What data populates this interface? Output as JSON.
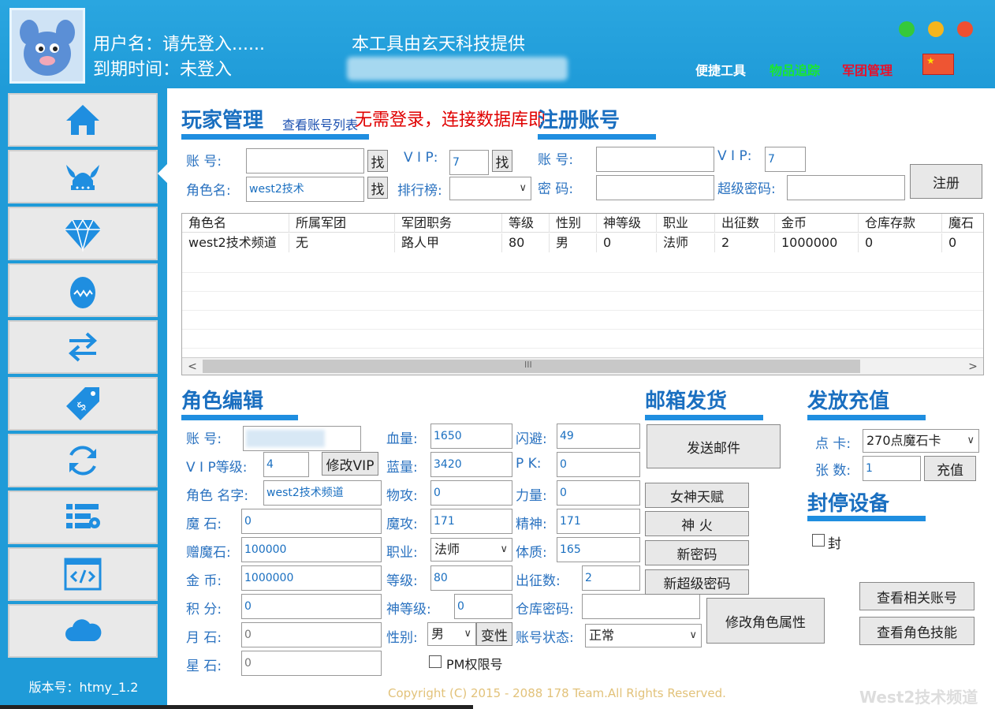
{
  "header": {
    "username_line": "用户名：请先登入......",
    "expire_line": "到期时间：未登入",
    "provider": "本工具由玄天科技提供",
    "links": [
      {
        "label": "便捷工具",
        "color": "#ffffff"
      },
      {
        "label": "物品追踪",
        "color": "#19e633"
      },
      {
        "label": "军团管理",
        "color": "#e8102a"
      }
    ],
    "flag_glyph": "★",
    "window_dots": [
      "#35c93a",
      "#f6b51c",
      "#ef4f30"
    ]
  },
  "sidebar": {
    "items": [
      "home-icon",
      "viking-helmet-icon",
      "diamond-icon",
      "egg-icon",
      "swap-arrows-icon",
      "price-tag-icon",
      "refresh-icon",
      "list-settings-icon",
      "code-window-icon",
      "cloud-icon"
    ],
    "version": "版本号：htmy_1.2"
  },
  "player": {
    "title": "玩家管理",
    "view_list_link": "查看账号列表",
    "notice": "无需登录，连接数据库即",
    "account_label": "账  号:",
    "role_label": "角色名:",
    "role_value": "west2技术",
    "vip_label": "V I P:",
    "vip_value": "7",
    "rank_label": "排行榜:",
    "find_label": "找"
  },
  "register": {
    "title": "注册账号",
    "account_label": "账  号:",
    "password_label": "密  码:",
    "vip_label": "V I P:",
    "vip_value": "7",
    "super_pw_label": "超级密码:",
    "register_button": "注册"
  },
  "table": {
    "columns": [
      "角色名",
      "所属军团",
      "军团职务",
      "等级",
      "性别",
      "神等级",
      "职业",
      "出征数",
      "金币",
      "仓库存款",
      "魔石"
    ],
    "rows": [
      [
        "west2技术频道",
        "无",
        "路人甲",
        "80",
        "男",
        "0",
        "法师",
        "2",
        "1000000",
        "0",
        "0"
      ]
    ],
    "scroll_thumb": "III"
  },
  "role_edit": {
    "title": "角色编辑",
    "account_label": "账  号:",
    "vip_level_label": "V I P等级:",
    "vip_level_value": "4",
    "modify_vip": "修改VIP",
    "role_name_label": "角色 名字:",
    "role_name_value": "west2技术频道",
    "magic_stone_label": "魔  石:",
    "magic_stone_value": "0",
    "gift_stone_label": "赠魔石:",
    "gift_stone_value": "100000",
    "gold_label": "金  币:",
    "gold_value": "1000000",
    "points_label": "积  分:",
    "points_value": "0",
    "moon_stone_label": "月  石:",
    "moon_stone_value": "0",
    "star_stone_label": "星  石:",
    "star_stone_value": "0",
    "hp_label": "血量:",
    "hp_value": "1650",
    "mp_label": "蓝量:",
    "mp_value": "3420",
    "phy_atk_label": "物攻:",
    "phy_atk_value": "0",
    "mag_atk_label": "魔攻:",
    "mag_atk_value": "171",
    "job_label": "职业:",
    "job_value": "法师",
    "level_label": "等级:",
    "level_value": "80",
    "god_level_label": "神等级:",
    "god_level_value": "0",
    "gender_label": "性别:",
    "gender_value": "男",
    "change_gender": "变性",
    "pm_label": "PM权限号",
    "dodge_label": "闪避:",
    "dodge_value": "49",
    "pk_label": "P  K:",
    "pk_value": "0",
    "str_label": "力量:",
    "str_value": "0",
    "spirit_label": "精神:",
    "spirit_value": "171",
    "con_label": "体质:",
    "con_value": "165",
    "expedition_label": "出征数:",
    "expedition_value": "2",
    "warehouse_pw_label": "仓库密码:",
    "account_status_label": "账号状态:",
    "account_status_value": "正常",
    "modify_attr": "修改角色属性"
  },
  "mail": {
    "title": "邮箱发货",
    "send_mail": "发送邮件",
    "goddess_talent": "女神天赋",
    "divine_fire": "神  火",
    "new_password": "新密码",
    "new_super_password": "新超级密码"
  },
  "recharge": {
    "title": "发放充值",
    "card_label": "点 卡:",
    "card_value": "270点魔石卡",
    "count_label": "张 数:",
    "count_value": "1",
    "recharge_button": "充值"
  },
  "ban": {
    "title": "封停设备",
    "ban_label": "封"
  },
  "actions": {
    "view_related": "查看相关账号",
    "view_skills": "查看角色技能"
  },
  "footer": {
    "copyright": "Copyright (C) 2015 - 2088 178 Team.All Rights Reserved.",
    "watermark": "West2技术频道"
  }
}
